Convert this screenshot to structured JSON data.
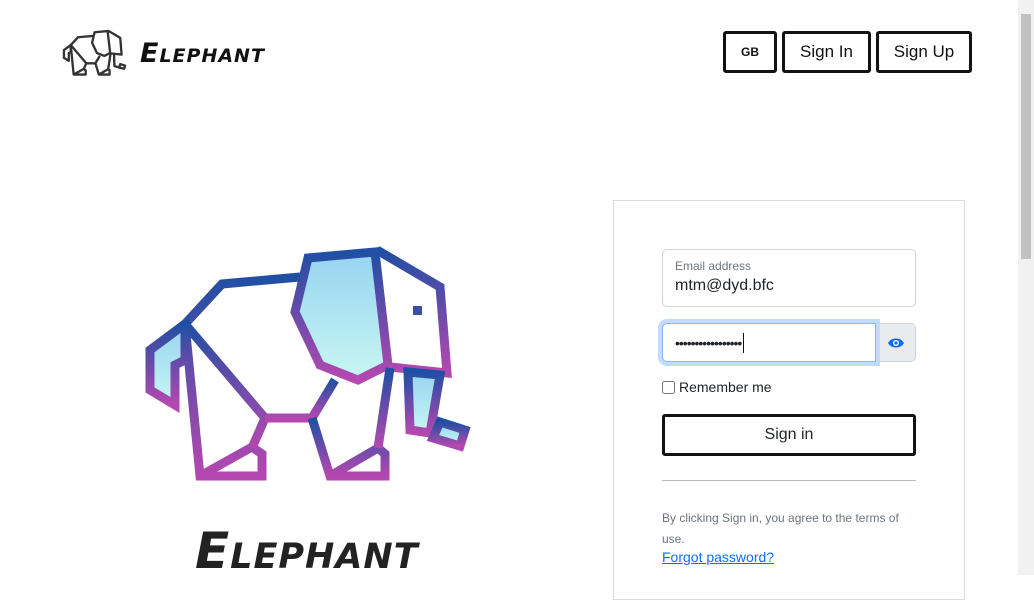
{
  "header": {
    "brand": "Elephant",
    "lang_label": "GB",
    "signin_label": "Sign In",
    "signup_label": "Sign Up"
  },
  "hero": {
    "brand": "Elephant"
  },
  "form": {
    "email_label": "Email address",
    "email_value": "mtm@dyd.bfc",
    "password_value": "•••••••••••••••••",
    "remember_label": "Remember me",
    "submit_label": "Sign in",
    "terms": "By clicking Sign in, you agree to the terms of use.",
    "forgot_label": "Forgot password?"
  },
  "colors": {
    "accent": "#0d6efd",
    "gradient_top": "#1f4fa3",
    "gradient_bottom": "#b548b0"
  }
}
